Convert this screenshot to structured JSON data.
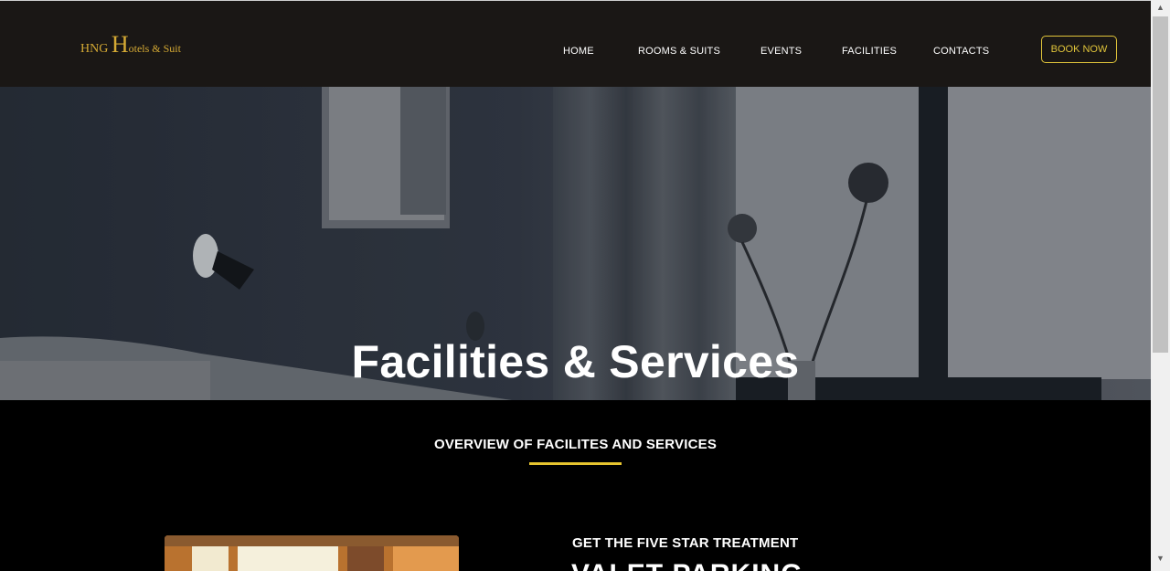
{
  "brand": {
    "logo_part1": "HNG ",
    "logo_part2": "H",
    "logo_part3": "otels & Suit",
    "accent_color": "#d4a934"
  },
  "nav": {
    "items": [
      "HOME",
      "ROOMS & SUITS",
      "EVENTS",
      "FACILITIES",
      "CONTACTS"
    ],
    "book_label": "BOOK NOW",
    "book_color": "#e0c43a"
  },
  "hero": {
    "title": "Facilities & Services"
  },
  "overview": {
    "title": "OVERVIEW OF FACILITES AND SERVICES",
    "underline_color": "#e6c42f"
  },
  "feature": {
    "kicker": "GET THE FIVE STAR TREATMENT",
    "heading": "VALET PARKING"
  },
  "scrollbar": {
    "up_icon": "▲",
    "down_icon": "▼"
  }
}
